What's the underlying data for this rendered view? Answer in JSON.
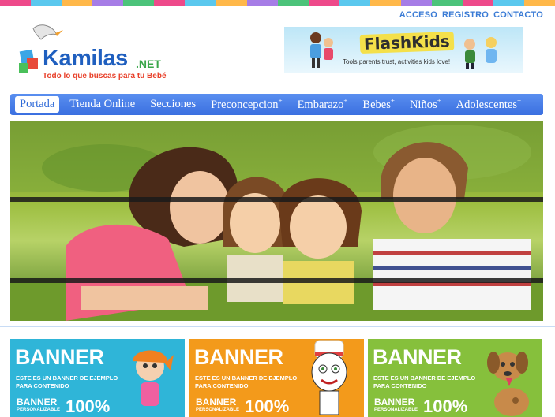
{
  "colorbar": [
    "#ee4a8a",
    "#5bc8ee",
    "#ffb84a",
    "#a67de6",
    "#4cc37a",
    "#ee4a8a",
    "#5bc8ee",
    "#ffb84a",
    "#a67de6",
    "#4cc37a",
    "#ee4a8a",
    "#5bc8ee",
    "#ffb84a",
    "#a67de6",
    "#4cc37a",
    "#ee4a8a",
    "#5bc8ee",
    "#ffb84a"
  ],
  "top_links": {
    "login": "ACCESO",
    "register": "REGISTRO",
    "contact": "CONTACTO"
  },
  "logo": {
    "name": "Kamilas",
    "suffix": ".NET",
    "tagline": "Todo lo que buscas para tu Bebé"
  },
  "ad": {
    "title": "FlashKids",
    "tagline": "Tools parents trust, activities kids love!"
  },
  "nav": [
    {
      "label": "Portada",
      "active": true,
      "has_submenu": false
    },
    {
      "label": "Tienda Online",
      "active": false,
      "has_submenu": false
    },
    {
      "label": "Secciones",
      "active": false,
      "has_submenu": false
    },
    {
      "label": "Preconcepcion",
      "active": false,
      "has_submenu": true
    },
    {
      "label": "Embarazo",
      "active": false,
      "has_submenu": true
    },
    {
      "label": "Bebes",
      "active": false,
      "has_submenu": true
    },
    {
      "label": "Niños",
      "active": false,
      "has_submenu": true
    },
    {
      "label": "Adolescentes",
      "active": false,
      "has_submenu": true
    }
  ],
  "hero": {
    "image": "family-photo"
  },
  "banners": [
    {
      "title": "BANNER",
      "text": "ESTE ES UN BANNER DE EJEMPLO PARA CONTENIDO",
      "foot_line1": "BANNER",
      "foot_line2": "PERSONALIZABLE",
      "percent": "100%",
      "color": "#2fb5d8",
      "mascot": "girl-icon"
    },
    {
      "title": "BANNER",
      "text": "ESTE ES UN BANNER DE EJEMPLO PARA CONTENIDO",
      "foot_line1": "BANNER",
      "foot_line2": "PERSONALIZABLE",
      "percent": "100%",
      "color": "#f39a1b",
      "mascot": "chef-icon"
    },
    {
      "title": "BANNER",
      "text": "ESTE ES UN BANNER DE EJEMPLO PARA CONTENIDO",
      "foot_line1": "BANNER",
      "foot_line2": "PERSONALIZABLE",
      "percent": "100%",
      "color": "#86c03c",
      "mascot": "dog-icon"
    }
  ],
  "submenu_glyph": "+"
}
